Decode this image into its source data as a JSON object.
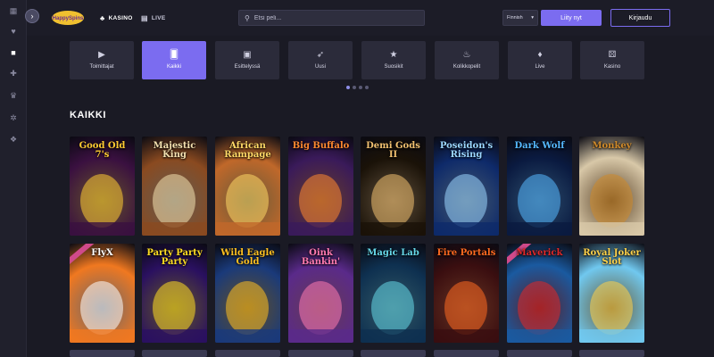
{
  "header": {
    "logo_alt": "HappySpins",
    "nav": [
      {
        "label": "KASINO",
        "icon": "club-icon"
      },
      {
        "label": "LIVE",
        "icon": "live-cards-icon"
      }
    ],
    "search_placeholder": "Etsi peli...",
    "language": "Finnish",
    "join_label": "Liity nyt",
    "login_label": "Kirjaudu"
  },
  "sidebar": {
    "icons": [
      "grid-icon",
      "heart-icon",
      "chat-icon",
      "gift-icon",
      "trophy-icon",
      "settings-icon",
      "support-icon"
    ]
  },
  "categories": [
    {
      "label": "Toimittajat",
      "icon": "play-icon",
      "active": false
    },
    {
      "label": "Kaikki",
      "icon": "cards-icon",
      "active": true
    },
    {
      "label": "Esittelyssä",
      "icon": "picture-icon",
      "active": false
    },
    {
      "label": "Uusi",
      "icon": "rocket-icon",
      "active": false
    },
    {
      "label": "Suosikit",
      "icon": "star-icon",
      "active": false
    },
    {
      "label": "Kolikkopelit",
      "icon": "cherry-icon",
      "active": false
    },
    {
      "label": "Live",
      "icon": "flame-icon",
      "active": false
    },
    {
      "label": "Kasino",
      "icon": "dice-icon",
      "active": false
    }
  ],
  "carousel_dots": {
    "count": 4,
    "active": 0
  },
  "section_title": "KAIKKI",
  "games": [
    {
      "title": "Good Old 7's",
      "bg": "#3a1040",
      "accent": "#ffcc33"
    },
    {
      "title": "Majestic King",
      "bg": "#8a4a20",
      "accent": "#f4e1b0"
    },
    {
      "title": "African Rampage",
      "bg": "#c0682a",
      "accent": "#ffd966"
    },
    {
      "title": "Big Buffalo",
      "bg": "#3a1a5a",
      "accent": "#ff8830"
    },
    {
      "title": "Demi Gods II",
      "bg": "#1a1208",
      "accent": "#f0c070"
    },
    {
      "title": "Poseidon's Rising",
      "bg": "#0e2a6a",
      "accent": "#9bd6ff"
    },
    {
      "title": "Dark Wolf",
      "bg": "#0a1a40",
      "accent": "#55b8ff"
    },
    {
      "title": "Monkey",
      "bg": "#d8c8a8",
      "accent": "#d08a2a"
    },
    {
      "title": "FlyX",
      "bg": "#f07820",
      "accent": "#ffffff"
    },
    {
      "title": "Party Party Party",
      "bg": "#2a1060",
      "accent": "#ffdd22"
    },
    {
      "title": "Wild Eagle Gold",
      "bg": "#1a3a7a",
      "accent": "#ffc020"
    },
    {
      "title": "Oink Bankin'",
      "bg": "#5a2a8a",
      "accent": "#ff7ab0"
    },
    {
      "title": "Magic Lab",
      "bg": "#0e3050",
      "accent": "#66d8e8"
    },
    {
      "title": "Fire Portals",
      "bg": "#3a0e10",
      "accent": "#ff6a20"
    },
    {
      "title": "Maverick",
      "bg": "#1a5aa0",
      "accent": "#e02828"
    },
    {
      "title": "Royal Joker Slot",
      "bg": "#70c8ef",
      "accent": "#ffd24a"
    }
  ]
}
